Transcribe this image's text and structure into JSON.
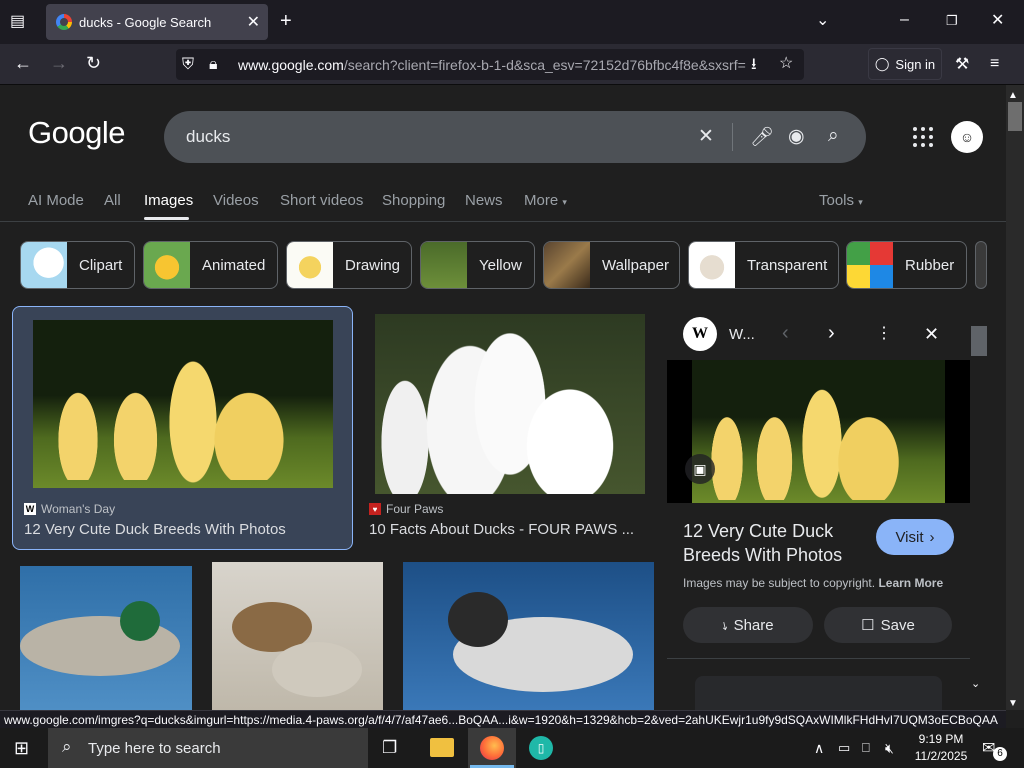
{
  "browser": {
    "tab_title": "ducks - Google Search",
    "url_host": "www.google.com",
    "url_rest": "/search?client=firefox-b-1-d&sca_esv=72152d76bfbc4f8e&sxsrf=",
    "sign_in_label": "Sign in"
  },
  "google": {
    "logo_text": "Google",
    "query": "ducks",
    "tabs": [
      "AI Mode",
      "All",
      "Images",
      "Videos",
      "Short videos",
      "Shopping",
      "News",
      "More"
    ],
    "active_tab": "Images",
    "tools_label": "Tools",
    "chips": [
      "Clipart",
      "Animated",
      "Drawing",
      "Yellow",
      "Wallpaper",
      "Transparent",
      "Rubber"
    ]
  },
  "results": [
    {
      "source": "Woman's Day",
      "title": "12 Very Cute Duck Breeds With Photos"
    },
    {
      "source": "Four Paws",
      "title": "10 Facts About Ducks - FOUR PAWS ..."
    }
  ],
  "panel": {
    "site_initial": "W",
    "site_name": "W...",
    "title_line1": "12 Very Cute Duck",
    "title_line2": "Breeds With Photos",
    "visit_label": "Visit",
    "copyright_text": "Images may be subject to copyright.",
    "learn_more": "Learn More",
    "share_label": "Share",
    "save_label": "Save"
  },
  "status_url": "www.google.com/imgres?q=ducks&imgurl=https://media.4-paws.org/a/f/4/7/af47ae6...BoQAA...i&w=1920&h=1329&hcb=2&ved=2ahUKEwjr1u9fy9dSQAxWIMlkFHdHvI7UQM3oECBoQAA",
  "taskbar": {
    "search_placeholder": "Type here to search",
    "time": "9:19 PM",
    "date": "11/2/2025",
    "notification_count": "6"
  },
  "colors": {
    "accent_blue": "#8ab4f8",
    "panel_highlight": "#394457"
  }
}
